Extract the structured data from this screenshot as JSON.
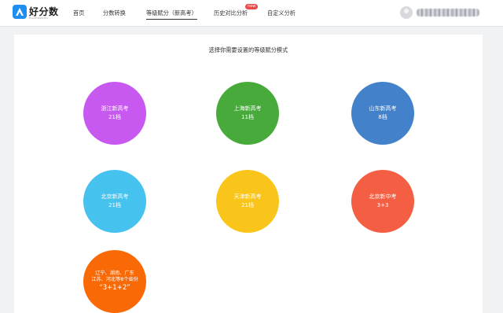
{
  "header": {
    "logo": {
      "name": "好分数",
      "subtitle": "HAOFENSHU"
    },
    "nav": [
      {
        "label": "首页"
      },
      {
        "label": "分数转换"
      },
      {
        "label": "等级赋分（新高考）"
      },
      {
        "label": "历史对比分析",
        "badge": "new"
      },
      {
        "label": "自定义分析"
      }
    ],
    "active_nav": "等级赋分（新高考）"
  },
  "main": {
    "title": "选择你需要设置的等级赋分模式",
    "modes": [
      {
        "name": "浙江新高考",
        "count": "21档",
        "color": "#c759f0"
      },
      {
        "name": "上海新高考",
        "count": "11档",
        "color": "#47aa3b"
      },
      {
        "name": "山东新高考",
        "count": "8档",
        "color": "#4381cb"
      },
      {
        "name": "北京新高考",
        "count": "21档",
        "color": "#45c2ee"
      },
      {
        "name": "天津新高考",
        "count": "21档",
        "color": "#f9c51b"
      },
      {
        "name": "北京新中考",
        "count": "3+3",
        "color": "#f45f43"
      }
    ],
    "mode_312": {
      "line1": "辽宁、湖南、广东",
      "line2": "江苏、河北等8个省份",
      "scheme": "“3+1+2”",
      "color": "#f96a07"
    }
  }
}
